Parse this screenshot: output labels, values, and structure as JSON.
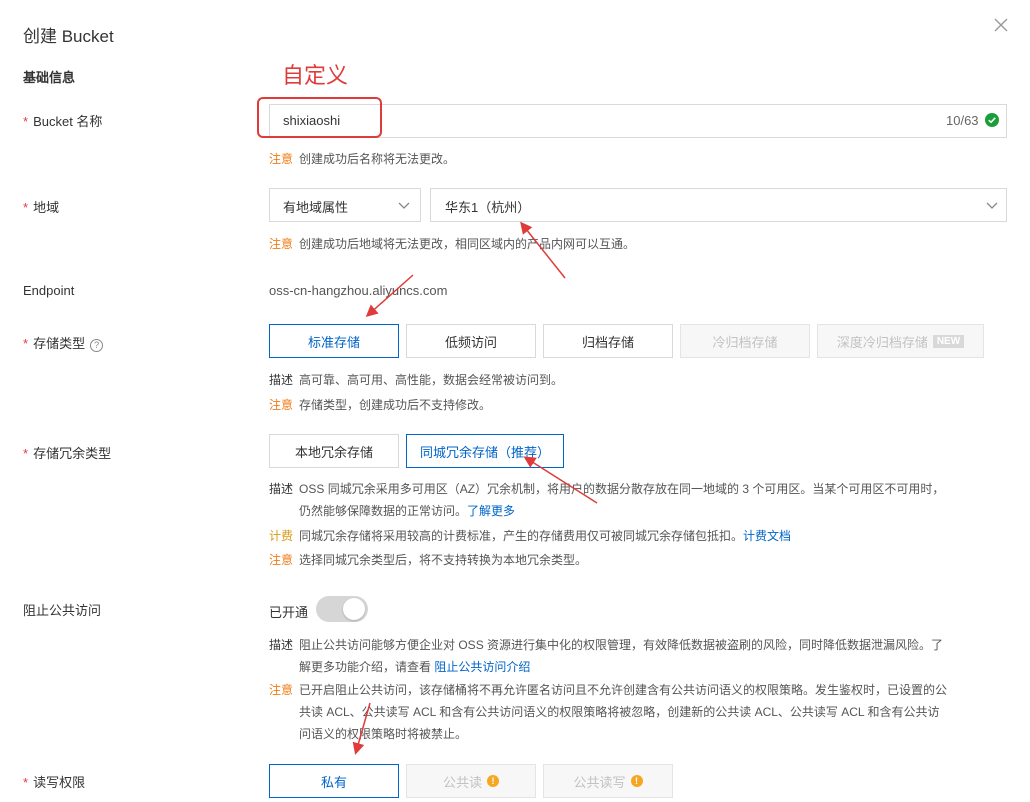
{
  "dialog": {
    "title": "创建 Bucket",
    "close_icon": "close-icon"
  },
  "section": {
    "basic_info": "基础信息"
  },
  "annotation": {
    "custom_text": "自定义",
    "color": "#e03b3b"
  },
  "bucket_name": {
    "required_mark": "*",
    "label": "Bucket 名称",
    "value": "shixiaoshi",
    "counter": "10/63",
    "note_key": "注意",
    "note_text": "创建成功后名称将无法更改。"
  },
  "region": {
    "required_mark": "*",
    "label": "地域",
    "type_select": "有地域属性",
    "region_select": "华东1（杭州）",
    "note_key": "注意",
    "note_text": "创建成功后地域将无法更改，相同区域内的产品内网可以互通。"
  },
  "endpoint": {
    "label": "Endpoint",
    "value": "oss-cn-hangzhou.aliyuncs.com"
  },
  "storage_class": {
    "required_mark": "*",
    "label": "存储类型",
    "options": [
      "标准存储",
      "低频访问",
      "归档存储",
      "冷归档存储",
      "深度冷归档存储"
    ],
    "new_badge": "NEW",
    "desc_key": "描述",
    "desc_text": "高可靠、高可用、高性能，数据会经常被访问到。",
    "note_key": "注意",
    "note_text": "存储类型，创建成功后不支持修改。"
  },
  "redundancy": {
    "required_mark": "*",
    "label": "存储冗余类型",
    "options": [
      "本地冗余存储",
      "同城冗余存储（推荐）"
    ],
    "desc_key": "描述",
    "desc_text": "OSS 同城冗余采用多可用区（AZ）冗余机制，将用户的数据分散存放在同一地域的 3 个可用区。当某个可用区不可用时，",
    "desc_text2": "仍然能够保障数据的正常访问。",
    "desc_link": "了解更多",
    "fee_key": "计费",
    "fee_text": "同城冗余存储将采用较高的计费标准，产生的存储费用仅可被同城冗余存储包抵扣。",
    "fee_link": "计费文档",
    "note_key": "注意",
    "note_text": "选择同城冗余类型后，将不支持转换为本地冗余类型。"
  },
  "block_public": {
    "label": "阻止公共访问",
    "state_text": "已开通",
    "desc_key": "描述",
    "desc_line1": "阻止公共访问能够方便企业对 OSS 资源进行集中化的权限管理，有效降低数据被盗刷的风险，同时降低数据泄漏风险。了",
    "desc_line2": "解更多功能介绍，请查看",
    "desc_link": "阻止公共访问介绍",
    "note_key": "注意",
    "note_line1": "已开启阻止公共访问，该存储桶将不再允许匿名访问且不允许创建含有公共访问语义的权限策略。发生鉴权时，已设置的公",
    "note_line2": "共读 ACL、公共读写 ACL 和含有公共访问语义的权限策略将被忽略，创建新的公共读 ACL、公共读写 ACL 和含有公共访",
    "note_line3": "问语义的权限策略时将被禁止。"
  },
  "acl": {
    "required_mark": "*",
    "label": "读写权限",
    "options": [
      "私有",
      "公共读",
      "公共读写"
    ]
  }
}
